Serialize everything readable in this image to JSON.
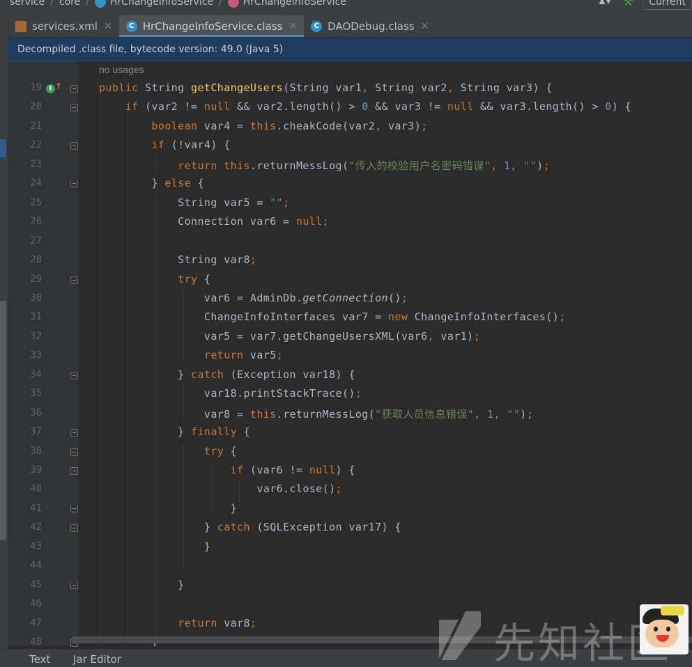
{
  "breadcrumb": {
    "items": [
      "service",
      "core",
      "HrChangeInfoService",
      "HrChangeInfoService"
    ],
    "run_config": "Current"
  },
  "tabs": [
    {
      "label": "services.xml",
      "icon": "xml-file-icon",
      "active": false
    },
    {
      "label": "HrChangeInfoService.class",
      "icon": "class-icon",
      "active": true
    },
    {
      "label": "DAODebug.class",
      "icon": "class-icon",
      "active": false
    }
  ],
  "banner": "Decompiled .class file, bytecode version: 49.0 (Java 5)",
  "editor": {
    "usage_hint": "no usages",
    "line_numbers": [
      "19",
      "20",
      "21",
      "22",
      "23",
      "24",
      "25",
      "26",
      "27",
      "28",
      "29",
      "30",
      "31",
      "32",
      "33",
      "34",
      "35",
      "36",
      "37",
      "38",
      "39",
      "40",
      "41",
      "42",
      "43",
      "44",
      "45",
      "46",
      "47",
      "48"
    ]
  },
  "bottom_tabs": [
    "Text",
    "Jar Editor"
  ],
  "watermark": "先知社区",
  "colors": {
    "keyword": "#cc7832",
    "method": "#ffc66d",
    "string": "#6a8759",
    "number": "#6897bb",
    "text": "#a9b7c6",
    "banner_bg": "#1f3b5e",
    "active_tab_underline": "#4a88c7"
  }
}
